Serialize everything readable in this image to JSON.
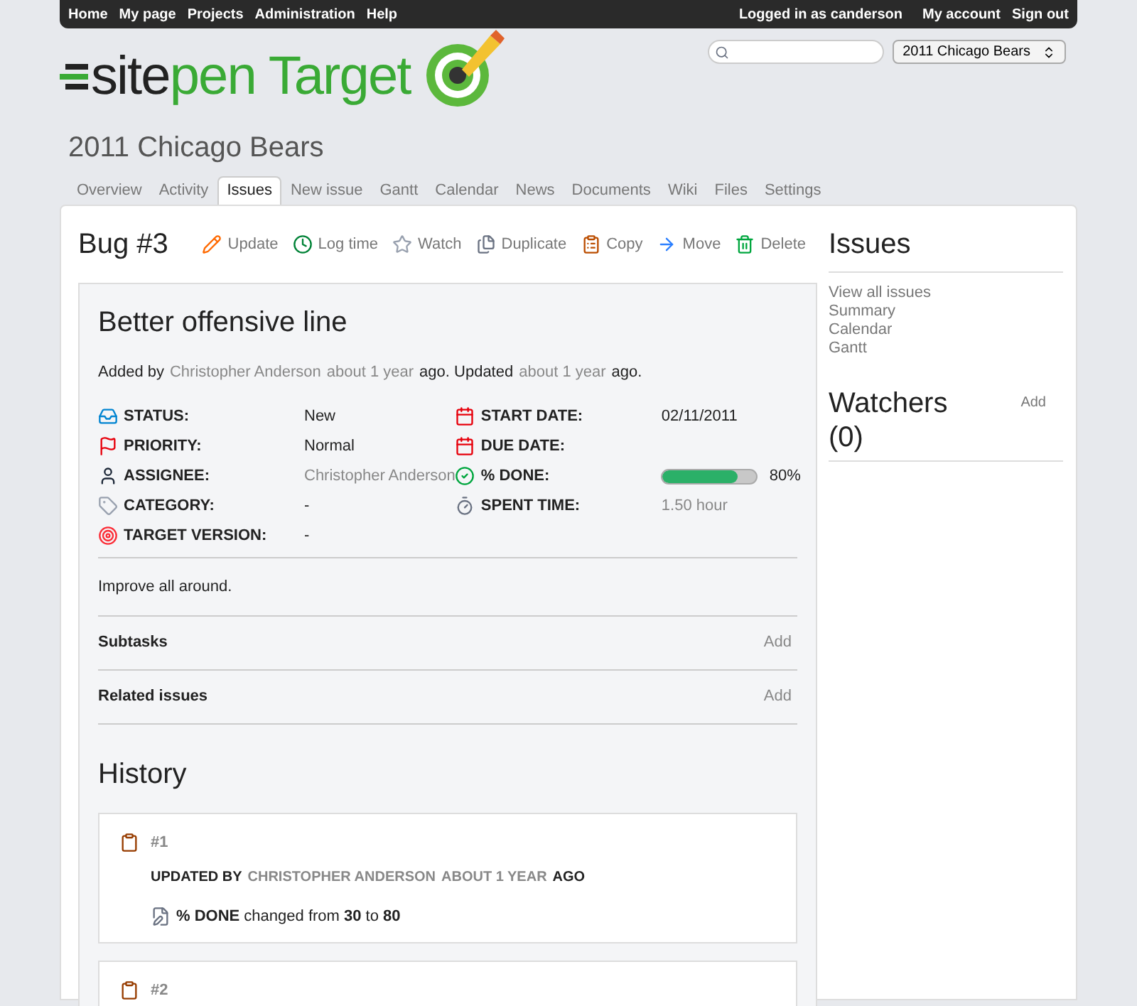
{
  "top_menu": {
    "left": [
      "Home",
      "My page",
      "Projects",
      "Administration",
      "Help"
    ],
    "logged_in": "Logged in as canderson",
    "right": [
      "My account",
      "Sign out"
    ]
  },
  "logo": {
    "first": "site",
    "second": "pen Target"
  },
  "project_select": {
    "value": "2011 Chicago Bears"
  },
  "project_title": "2011 Chicago Bears",
  "tabs": [
    {
      "label": "Overview",
      "selected": false
    },
    {
      "label": "Activity",
      "selected": false
    },
    {
      "label": "Issues",
      "selected": true
    },
    {
      "label": "New issue",
      "selected": false
    },
    {
      "label": "Gantt",
      "selected": false
    },
    {
      "label": "Calendar",
      "selected": false
    },
    {
      "label": "News",
      "selected": false
    },
    {
      "label": "Documents",
      "selected": false
    },
    {
      "label": "Wiki",
      "selected": false
    },
    {
      "label": "Files",
      "selected": false
    },
    {
      "label": "Settings",
      "selected": false
    }
  ],
  "issue": {
    "heading": "Bug #3",
    "actions": [
      "Update",
      "Log time",
      "Watch",
      "Duplicate",
      "Copy",
      "Move",
      "Delete"
    ],
    "subject": "Better offensive line",
    "added_line": [
      {
        "kind": "text",
        "text": "Added by"
      },
      {
        "kind": "link",
        "text": "Christopher Anderson"
      },
      {
        "kind": "link",
        "text": "about 1 year"
      },
      {
        "kind": "text",
        "text": "ago. Updated"
      },
      {
        "kind": "link",
        "text": "about 1 year"
      },
      {
        "kind": "text",
        "text": "ago."
      }
    ],
    "attributes_left": [
      {
        "label": "STATUS:",
        "value": "New",
        "kind": "text"
      },
      {
        "label": "PRIORITY:",
        "value": "Normal",
        "kind": "text"
      },
      {
        "label": "ASSIGNEE:",
        "value": "Christopher Anderson",
        "kind": "link"
      },
      {
        "label": "CATEGORY:",
        "value": "-",
        "kind": "text"
      },
      {
        "label": "TARGET VERSION:",
        "value": "-",
        "kind": "text"
      }
    ],
    "attributes_right": [
      {
        "label": "START DATE:",
        "value": "02/11/2011",
        "kind": "text"
      },
      {
        "label": "DUE DATE:",
        "kind": "text"
      },
      {
        "label": "% DONE:",
        "kind": "progress",
        "level": 0.8,
        "value": "80%"
      },
      {
        "label": "SPENT TIME:",
        "value": "1.50 hour",
        "kind": "link"
      }
    ],
    "description": "Improve all around.",
    "sections": [
      {
        "title": "Subtasks",
        "action": "Add"
      },
      {
        "title": "Related issues",
        "action": "Add"
      }
    ]
  },
  "history": {
    "title": "History",
    "entries": [
      {
        "number": "#1",
        "updated_by": "UPDATED BY",
        "author": "CHRISTOPHER ANDERSON",
        "time": "ABOUT 1 YEAR",
        "ago": "AGO",
        "details": [
          "**% DONE** changed from **30** to **80**"
        ]
      },
      {
        "number": "#2"
      }
    ]
  },
  "sidebar": {
    "issues_title": "Issues",
    "links": [
      "View all issues",
      "Summary",
      "Calendar",
      "Gantt"
    ],
    "watchers_title": "Watchers (0)",
    "watchers_action": "Add"
  }
}
